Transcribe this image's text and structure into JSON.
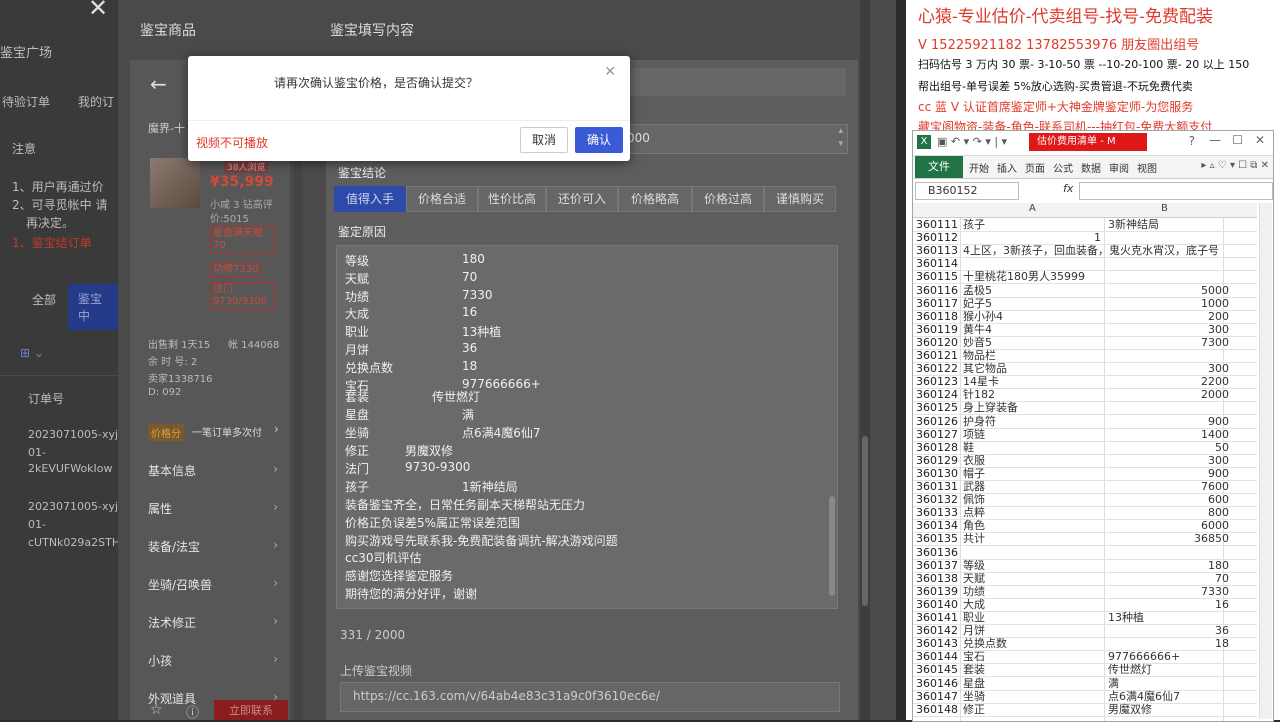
{
  "left_page": {
    "title": "鉴宝广场",
    "tab_my_orders_partial": "待验订单",
    "tab_my_partial": "我的订",
    "notice_label": "注意",
    "notice_1": "1、用户再通过价",
    "notice_2": "2、可寻觅帐中 请",
    "notice_3": "再决定。",
    "notice_4": "1、鉴宝结订单",
    "filter_all": "全部",
    "filter_btn": "鉴宝中",
    "view_icon": "grid-icon",
    "order_col": "订单号",
    "order_1a": "2023071005-xyj",
    "order_1b": "01-",
    "order_1c": "2kEVUFWokIow",
    "order_2a": "2023071005-xyj",
    "order_2b": "01-",
    "order_2c": "cUTNk029a2STH"
  },
  "app": {
    "header_left": "鉴宝商品",
    "header_right": "鉴宝填写内容",
    "back_icon": "arrow-left-icon",
    "product": {
      "title_partial": "魔界-十",
      "price": "¥35,999",
      "hot_badge": "38人浏览",
      "seller_note": "小咸 3 钻高评",
      "price_value_label": "价:5015",
      "tag_1": "星盘满天赋70",
      "tag_2": "功绩7330",
      "tag_3": "法门9730/9300",
      "meta_1": "出售剩 1天15",
      "meta_2": "帐 144068",
      "meta_3": "余  时  号:  2",
      "meta_4": "卖家1338716",
      "meta_5": "D:  092",
      "split_badge": "价格分",
      "split_text": "一笔订单多次付",
      "nav": [
        "基本信息",
        "属性",
        "装备/法宝",
        "坐骑/召唤兽",
        "法术修正",
        "小孩",
        "外观道具"
      ],
      "bottom_red_btn": "立即联系"
    },
    "form": {
      "value_partial": "000",
      "conclusion_label": "鉴宝结论",
      "tabs": [
        "值得入手",
        "价格合适",
        "性价比高",
        "还价可入",
        "价格略高",
        "价格过高",
        "谨慎购买"
      ],
      "reason_label": "鉴定原因",
      "reason_pairs": [
        [
          "等级",
          "180"
        ],
        [
          "天赋",
          "70"
        ],
        [
          "功绩",
          "7330"
        ],
        [
          "大成",
          "16"
        ],
        [
          "职业",
          "13种植"
        ],
        [
          "月饼",
          "36"
        ],
        [
          "兑换点数",
          "18"
        ],
        [
          "宝石",
          "977666666+"
        ]
      ],
      "suit_label": "套装",
      "suit_value": "传世燃灯",
      "star_label": "星盘",
      "star_value": "满",
      "mount_label": "坐骑",
      "mount_value": "点6满4魔6仙7",
      "fix_label": "修正",
      "fix_value": "男魔双修",
      "fa_label": "法门",
      "fa_value": "9730-9300",
      "child_label": "孩子",
      "child_value": "1新神结局",
      "note_lines": [
        "装备鉴宝齐全，日常任务副本天梯帮站无压力",
        "价格正负误差5%属正常误差范围",
        "购买游戏号先联系我-免费配装备调抗-解决游戏问题",
        "cc30司机评估",
        "感谢您选择鉴定服务",
        "期待您的满分好评，谢谢"
      ],
      "char_count": "331 / 2000",
      "video_label": "上传鉴宝视频",
      "video_url": "https://cc.163.com/v/64ab4e83c31a9c0f3610ec6e/"
    }
  },
  "modal": {
    "message": "请再次确认鉴宝价格，是否确认提交？",
    "close_icon": "close-icon",
    "video_error": "视频不可播放",
    "cancel": "取消",
    "confirm": "确认"
  },
  "right_panel": {
    "line1": "心猿-专业估价-代卖组号-找号-免费配装",
    "line2": "V 15225921182   13782553976 朋友圈出组号",
    "line3": "扫码估号 3 万内 30 票- 3-10-50 票  --10-20-100 票- 20 以上 150",
    "line4": "帮出组号-单号误差 5%放心选购-买贵管退-不玩免费代卖",
    "line5": "cc 蓝 V 认证首席鉴定师+大神金牌鉴定师-为您服务",
    "line6": "藏宝阁物资-装备-角色-联系司机---抽红包-免费大额支付"
  },
  "excel": {
    "window_title": "估价费用清单 - M",
    "tabs": [
      "文件",
      "开始",
      "插入",
      "页面",
      "公式",
      "数据",
      "审阅",
      "视图"
    ],
    "name_box": "B360152",
    "fx": "fx",
    "col_a": "A",
    "col_b": "B",
    "rows": [
      [
        "360111",
        "孩子",
        "3新神结局"
      ],
      [
        "360112",
        "1",
        ""
      ],
      [
        "360113",
        "4上区，3新孩子，回血装备，鬼火克水宵汉，底子号",
        ""
      ],
      [
        "360114",
        "",
        ""
      ],
      [
        "360115",
        "十里桃花180男人35999",
        ""
      ],
      [
        "360116",
        "孟极5",
        "5000"
      ],
      [
        "360117",
        "妃子5",
        "1000"
      ],
      [
        "360118",
        "猴小孙4",
        "200"
      ],
      [
        "360119",
        "黄牛4",
        "300"
      ],
      [
        "360120",
        "妙音5",
        "7300"
      ],
      [
        "360121",
        "物品栏",
        ""
      ],
      [
        "360122",
        "其它物品",
        "300"
      ],
      [
        "360123",
        "14星卡",
        "2200"
      ],
      [
        "360124",
        "针182",
        "2000"
      ],
      [
        "360125",
        "身上穿装备",
        ""
      ],
      [
        "360126",
        "护身符",
        "900"
      ],
      [
        "360127",
        "项链",
        "1400"
      ],
      [
        "360128",
        "鞋",
        "50"
      ],
      [
        "360129",
        "衣服",
        "300"
      ],
      [
        "360130",
        "帽子",
        "900"
      ],
      [
        "360131",
        "武器",
        "7600"
      ],
      [
        "360132",
        "佩饰",
        "600"
      ],
      [
        "360133",
        "点粹",
        "800"
      ],
      [
        "360134",
        "角色",
        "6000"
      ],
      [
        "360135",
        "共计",
        "36850"
      ],
      [
        "360136",
        "",
        ""
      ],
      [
        "360137",
        "等级",
        "180"
      ],
      [
        "360138",
        "天赋",
        "70"
      ],
      [
        "360139",
        "功绩",
        "7330"
      ],
      [
        "360140",
        "大成",
        "16"
      ],
      [
        "360141",
        "职业",
        "13种植"
      ],
      [
        "360142",
        "月饼",
        "36"
      ],
      [
        "360143",
        "兑换点数",
        "18"
      ],
      [
        "360144",
        "宝石",
        "977666666+"
      ],
      [
        "360145",
        "套装",
        "传世燃灯"
      ],
      [
        "360146",
        "星盘",
        "满"
      ],
      [
        "360147",
        "坐骑",
        "点6满4魔6仙7"
      ],
      [
        "360148",
        "修正",
        "男魔双修"
      ]
    ]
  },
  "colors": {
    "accent": "#3b5bd6",
    "red": "#e03a2b",
    "excel_green": "#217346"
  }
}
